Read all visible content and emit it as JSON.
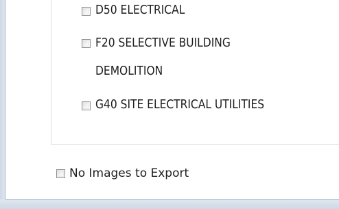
{
  "categories": [
    {
      "label": "D50 ELECTRICAL"
    },
    {
      "label_line1": "F20 SELECTIVE BUILDING",
      "label_line2": "DEMOLITION"
    },
    {
      "label": "G40 SITE ELECTRICAL UTILITIES"
    }
  ],
  "export_options": {
    "no_images_label": "No Images to Export"
  }
}
